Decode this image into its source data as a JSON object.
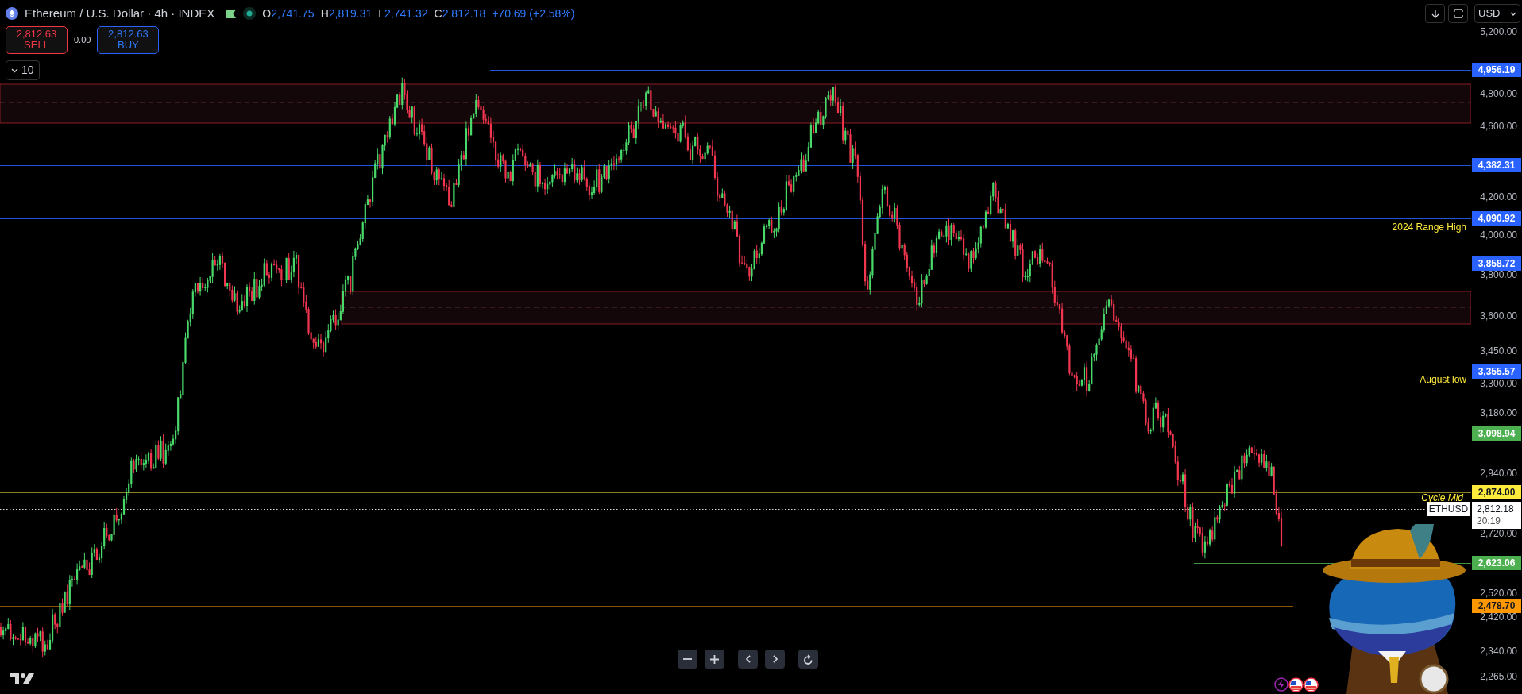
{
  "header": {
    "title": "Ethereum / U.S. Dollar · 4h · INDEX",
    "market_open": true,
    "ohlc": [
      {
        "label": "O",
        "value": "2,741.75"
      },
      {
        "label": "H",
        "value": "2,819.31"
      },
      {
        "label": "L",
        "value": "2,741.32"
      },
      {
        "label": "C",
        "value": "2,812.18"
      }
    ],
    "change": "+70.69 (+2.58%)"
  },
  "trade": {
    "sell": {
      "price": "2,812.63",
      "label": "SELL"
    },
    "spread": "0.00",
    "buy": {
      "price": "2,812.63",
      "label": "BUY"
    }
  },
  "volume_toggle": {
    "value": "10"
  },
  "toolbar": {
    "currency": "USD"
  },
  "price_axis": {
    "ticks": [
      "5,200.00",
      "4,800.00",
      "4,600.00",
      "4,200.00",
      "4,000.00",
      "3,800.00",
      "3,600.00",
      "3,450.00",
      "3,300.00",
      "3,180.00",
      "2,940.00",
      "2,720.00",
      "2,520.00",
      "2,420.00",
      "2,340.00",
      "2,265.00"
    ],
    "tags": [
      {
        "price": "4,956.19",
        "color": "#2962ff"
      },
      {
        "price": "4,382.31",
        "color": "#2962ff"
      },
      {
        "price": "4,090.92",
        "color": "#2962ff"
      },
      {
        "price": "3,858.72",
        "color": "#2962ff"
      },
      {
        "price": "3,355.57",
        "color": "#2962ff"
      },
      {
        "price": "3,098.94",
        "color": "#4caf50"
      },
      {
        "price": "2,874.00",
        "color": "#ffeb3b"
      },
      {
        "price": "2,623.06",
        "color": "#4caf50"
      },
      {
        "price": "2,478.70",
        "color": "#ff9800"
      }
    ],
    "current": {
      "symbol": "ETHUSD",
      "price": "2,812.18",
      "countdown": "20:19"
    }
  },
  "annotations": [
    {
      "text": "2024 Range High",
      "italic": false
    },
    {
      "text": "August low",
      "italic": false
    },
    {
      "text": "Cycle Mid",
      "italic": true
    }
  ]
}
